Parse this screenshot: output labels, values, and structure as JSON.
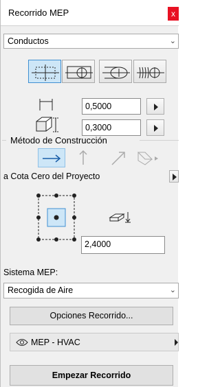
{
  "window": {
    "title": "Recorrido MEP",
    "close_label": "x"
  },
  "element_type": {
    "selected": "Conductos"
  },
  "shape_tools": [
    {
      "name": "rectangular"
    },
    {
      "name": "circular"
    },
    {
      "name": "oval"
    },
    {
      "name": "flexible"
    }
  ],
  "dimensions": {
    "width": "0,5000",
    "height": "0,3000"
  },
  "construction": {
    "heading": "Método de Construcción",
    "reference_label": "a Cota Cero del Proyecto",
    "elevation": "2,4000"
  },
  "system": {
    "label": "Sistema MEP:",
    "selected": "Recogida de Aire"
  },
  "routing_options_button": "Opciones Recorrido...",
  "layer": {
    "name": "MEP - HVAC"
  },
  "start_button": "Empezar Recorrido",
  "colors": {
    "accent": "#3f8fd2",
    "active_bg": "#cde6f7",
    "close_red": "#e81123"
  }
}
